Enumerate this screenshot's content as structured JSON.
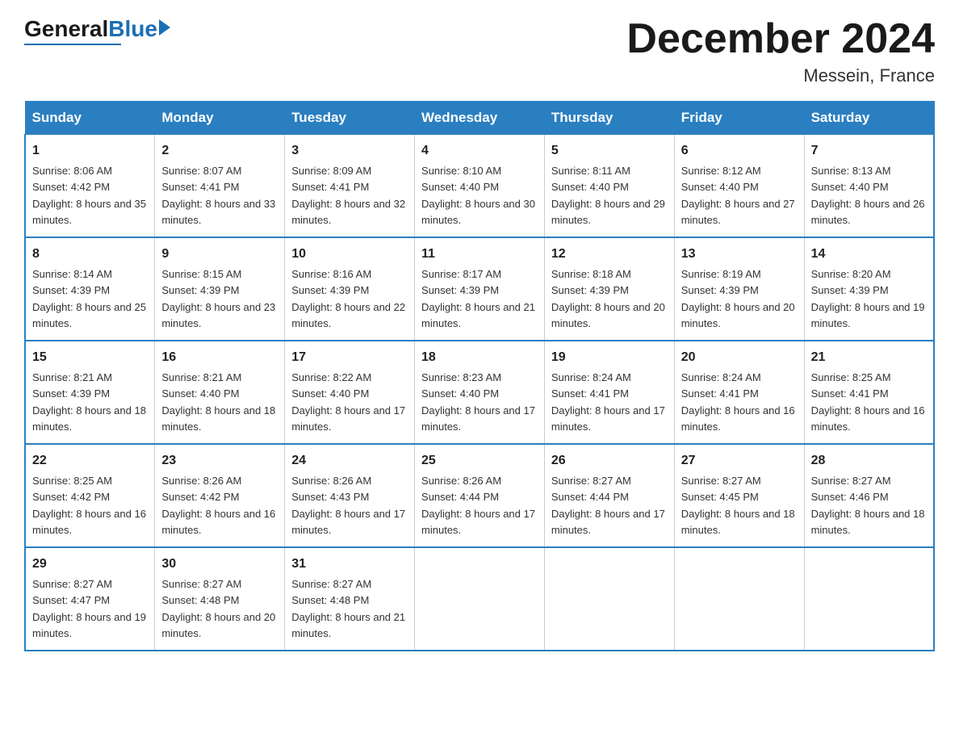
{
  "logo": {
    "general": "General",
    "blue": "Blue",
    "line": true
  },
  "header": {
    "title": "December 2024",
    "location": "Messein, France"
  },
  "days_of_week": [
    "Sunday",
    "Monday",
    "Tuesday",
    "Wednesday",
    "Thursday",
    "Friday",
    "Saturday"
  ],
  "weeks": [
    [
      {
        "day": "1",
        "sunrise": "8:06 AM",
        "sunset": "4:42 PM",
        "daylight": "8 hours and 35 minutes."
      },
      {
        "day": "2",
        "sunrise": "8:07 AM",
        "sunset": "4:41 PM",
        "daylight": "8 hours and 33 minutes."
      },
      {
        "day": "3",
        "sunrise": "8:09 AM",
        "sunset": "4:41 PM",
        "daylight": "8 hours and 32 minutes."
      },
      {
        "day": "4",
        "sunrise": "8:10 AM",
        "sunset": "4:40 PM",
        "daylight": "8 hours and 30 minutes."
      },
      {
        "day": "5",
        "sunrise": "8:11 AM",
        "sunset": "4:40 PM",
        "daylight": "8 hours and 29 minutes."
      },
      {
        "day": "6",
        "sunrise": "8:12 AM",
        "sunset": "4:40 PM",
        "daylight": "8 hours and 27 minutes."
      },
      {
        "day": "7",
        "sunrise": "8:13 AM",
        "sunset": "4:40 PM",
        "daylight": "8 hours and 26 minutes."
      }
    ],
    [
      {
        "day": "8",
        "sunrise": "8:14 AM",
        "sunset": "4:39 PM",
        "daylight": "8 hours and 25 minutes."
      },
      {
        "day": "9",
        "sunrise": "8:15 AM",
        "sunset": "4:39 PM",
        "daylight": "8 hours and 23 minutes."
      },
      {
        "day": "10",
        "sunrise": "8:16 AM",
        "sunset": "4:39 PM",
        "daylight": "8 hours and 22 minutes."
      },
      {
        "day": "11",
        "sunrise": "8:17 AM",
        "sunset": "4:39 PM",
        "daylight": "8 hours and 21 minutes."
      },
      {
        "day": "12",
        "sunrise": "8:18 AM",
        "sunset": "4:39 PM",
        "daylight": "8 hours and 20 minutes."
      },
      {
        "day": "13",
        "sunrise": "8:19 AM",
        "sunset": "4:39 PM",
        "daylight": "8 hours and 20 minutes."
      },
      {
        "day": "14",
        "sunrise": "8:20 AM",
        "sunset": "4:39 PM",
        "daylight": "8 hours and 19 minutes."
      }
    ],
    [
      {
        "day": "15",
        "sunrise": "8:21 AM",
        "sunset": "4:39 PM",
        "daylight": "8 hours and 18 minutes."
      },
      {
        "day": "16",
        "sunrise": "8:21 AM",
        "sunset": "4:40 PM",
        "daylight": "8 hours and 18 minutes."
      },
      {
        "day": "17",
        "sunrise": "8:22 AM",
        "sunset": "4:40 PM",
        "daylight": "8 hours and 17 minutes."
      },
      {
        "day": "18",
        "sunrise": "8:23 AM",
        "sunset": "4:40 PM",
        "daylight": "8 hours and 17 minutes."
      },
      {
        "day": "19",
        "sunrise": "8:24 AM",
        "sunset": "4:41 PM",
        "daylight": "8 hours and 17 minutes."
      },
      {
        "day": "20",
        "sunrise": "8:24 AM",
        "sunset": "4:41 PM",
        "daylight": "8 hours and 16 minutes."
      },
      {
        "day": "21",
        "sunrise": "8:25 AM",
        "sunset": "4:41 PM",
        "daylight": "8 hours and 16 minutes."
      }
    ],
    [
      {
        "day": "22",
        "sunrise": "8:25 AM",
        "sunset": "4:42 PM",
        "daylight": "8 hours and 16 minutes."
      },
      {
        "day": "23",
        "sunrise": "8:26 AM",
        "sunset": "4:42 PM",
        "daylight": "8 hours and 16 minutes."
      },
      {
        "day": "24",
        "sunrise": "8:26 AM",
        "sunset": "4:43 PM",
        "daylight": "8 hours and 17 minutes."
      },
      {
        "day": "25",
        "sunrise": "8:26 AM",
        "sunset": "4:44 PM",
        "daylight": "8 hours and 17 minutes."
      },
      {
        "day": "26",
        "sunrise": "8:27 AM",
        "sunset": "4:44 PM",
        "daylight": "8 hours and 17 minutes."
      },
      {
        "day": "27",
        "sunrise": "8:27 AM",
        "sunset": "4:45 PM",
        "daylight": "8 hours and 18 minutes."
      },
      {
        "day": "28",
        "sunrise": "8:27 AM",
        "sunset": "4:46 PM",
        "daylight": "8 hours and 18 minutes."
      }
    ],
    [
      {
        "day": "29",
        "sunrise": "8:27 AM",
        "sunset": "4:47 PM",
        "daylight": "8 hours and 19 minutes."
      },
      {
        "day": "30",
        "sunrise": "8:27 AM",
        "sunset": "4:48 PM",
        "daylight": "8 hours and 20 minutes."
      },
      {
        "day": "31",
        "sunrise": "8:27 AM",
        "sunset": "4:48 PM",
        "daylight": "8 hours and 21 minutes."
      },
      null,
      null,
      null,
      null
    ]
  ],
  "labels": {
    "sunrise": "Sunrise:",
    "sunset": "Sunset:",
    "daylight": "Daylight:"
  }
}
